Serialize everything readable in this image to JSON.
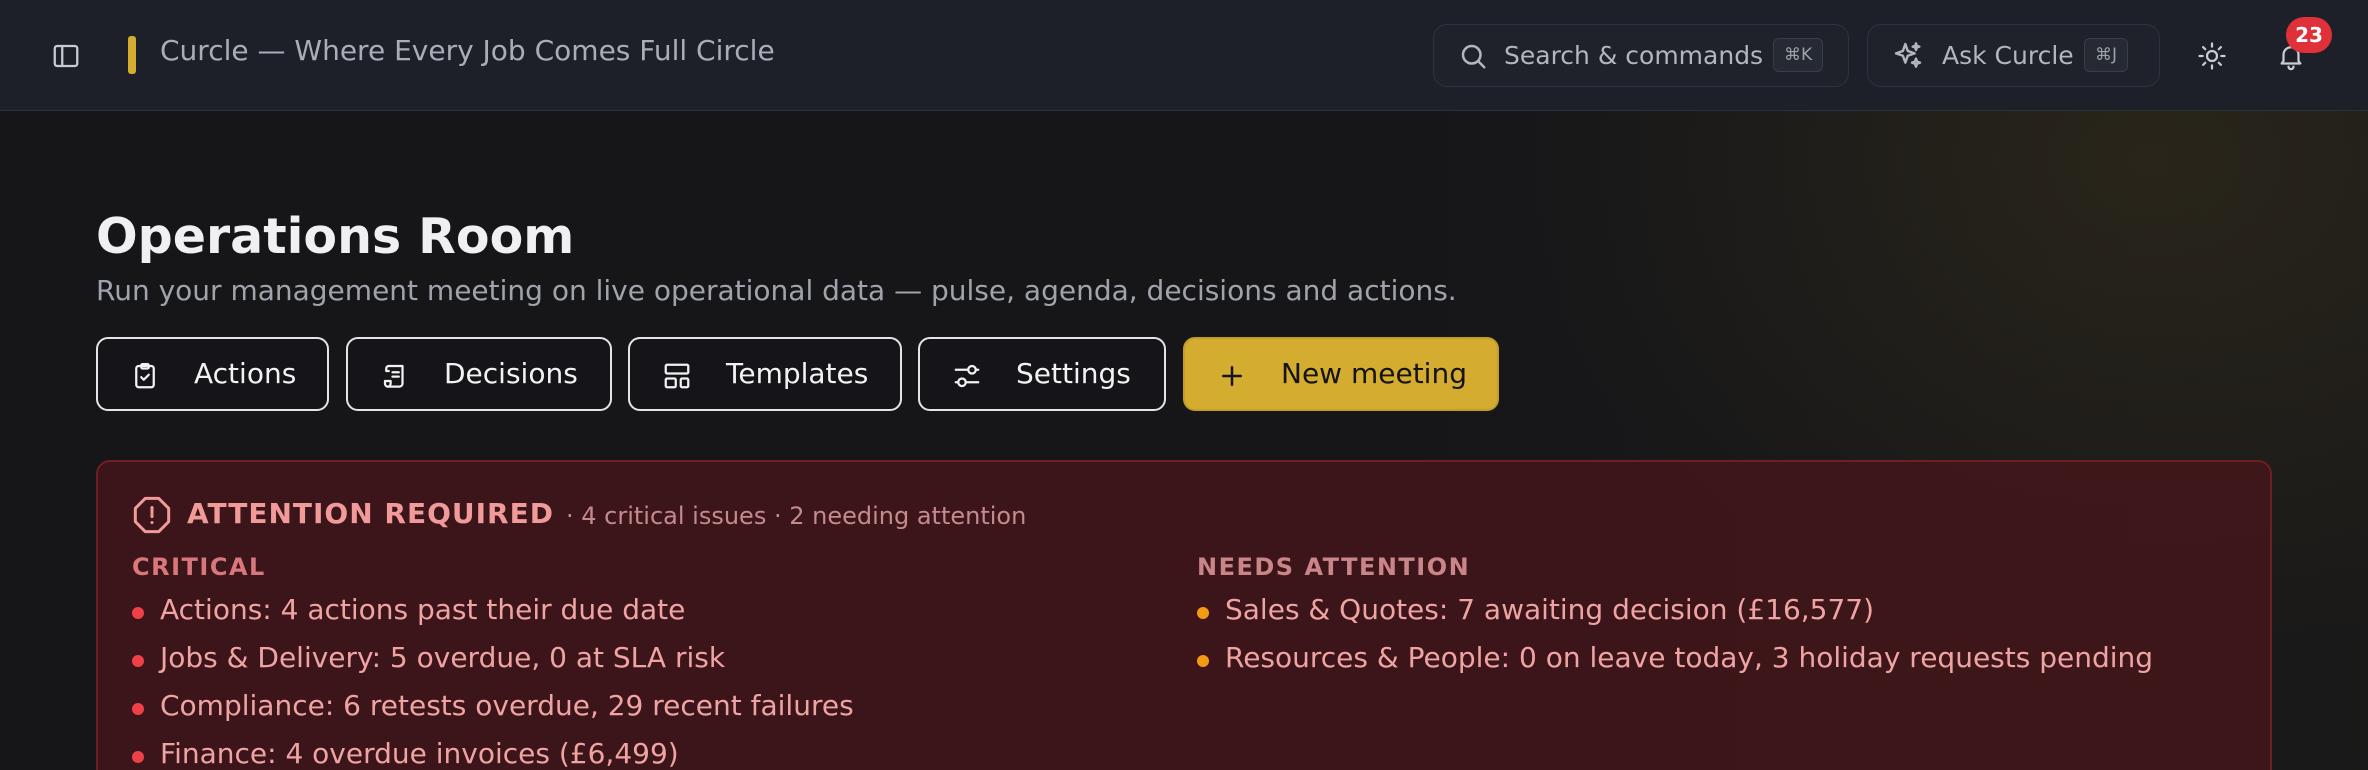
{
  "app": {
    "title": "Curcle — Where Every Job Comes Full Circle"
  },
  "header": {
    "search": {
      "label": "Search & commands",
      "shortcut": "⌘K"
    },
    "ask": {
      "label": "Ask Curcle",
      "shortcut": "⌘J"
    },
    "notifications": {
      "count": "23"
    },
    "icons": [
      "sidebar-toggle-icon",
      "search-icon",
      "sparkles-icon",
      "sun-icon",
      "bell-icon"
    ]
  },
  "page": {
    "title": "Operations Room",
    "subtitle": "Run your management meeting on live operational data — pulse, agenda, decisions and actions."
  },
  "toolbar": {
    "actions": "Actions",
    "decisions": "Decisions",
    "templates": "Templates",
    "settings": "Settings",
    "new_meeting": "New meeting"
  },
  "alert": {
    "title": "ATTENTION REQUIRED",
    "summary": "· 4 critical issues · 2 needing attention",
    "critical": {
      "heading": "CRITICAL",
      "items": [
        "Actions: 4 actions past their due date",
        "Jobs & Delivery: 5 overdue, 0 at SLA risk",
        "Compliance: 6 retests overdue, 29 recent failures",
        "Finance: 4 overdue invoices (£6,499)"
      ]
    },
    "attention": {
      "heading": "NEEDS ATTENTION",
      "items": [
        "Sales & Quotes: 7 awaiting decision (£16,577)",
        "Resources & People: 0 on leave today, 3 holiday requests pending"
      ]
    }
  },
  "colors": {
    "accent": "#d4ac2f",
    "critical": "#ef4048",
    "warning": "#f29b13",
    "badge": "#e0303a"
  }
}
